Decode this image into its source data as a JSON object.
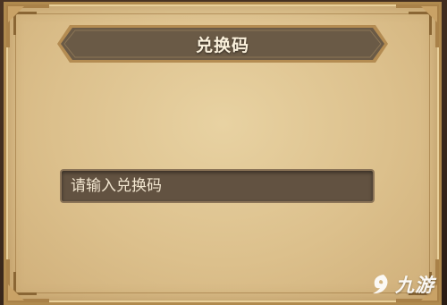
{
  "dialog": {
    "title": "兑换码",
    "code_input": {
      "placeholder": "请输入兑换码",
      "value": ""
    }
  },
  "watermark": {
    "brand": "九游",
    "logo_icon": "jiuyou-logo-icon"
  },
  "colors": {
    "panel_parchment": "#dcc08c",
    "panel_border": "#b08a4e",
    "title_banner": "#6a5a46",
    "title_text": "#fbf1dc",
    "input_background": "#625241",
    "input_text": "#f2e6d0",
    "background": "#3a281c"
  }
}
